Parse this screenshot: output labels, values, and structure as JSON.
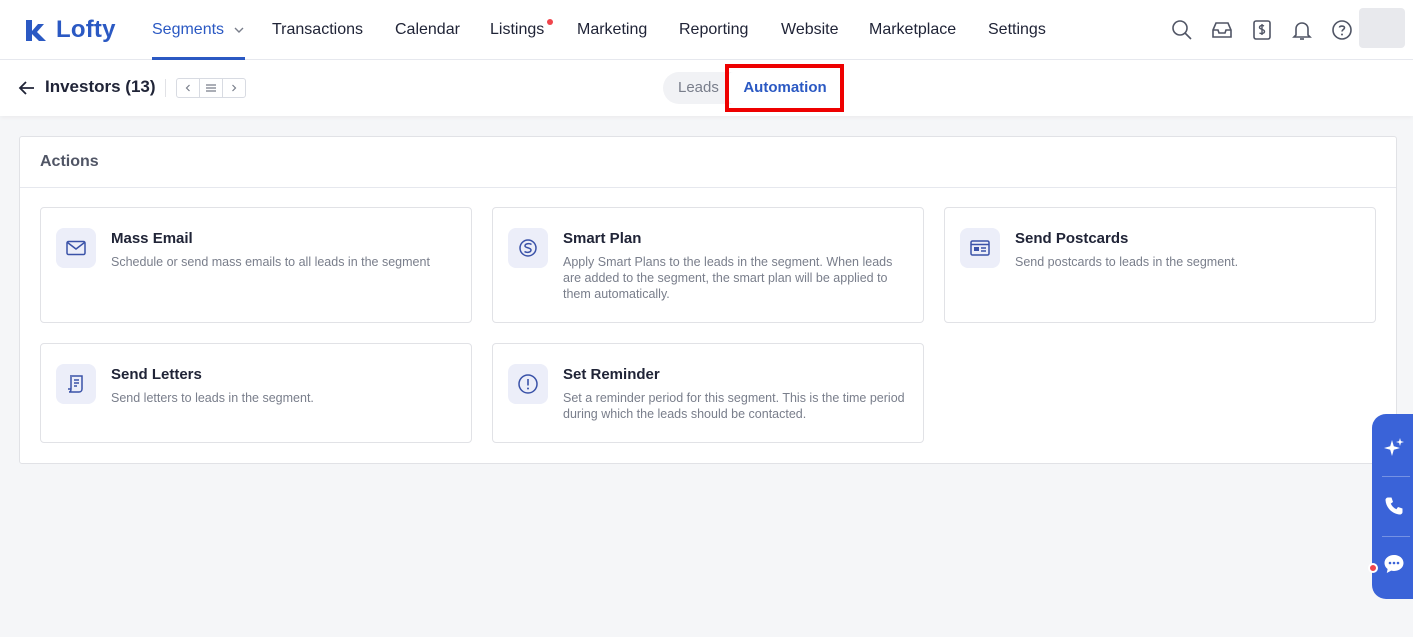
{
  "brand": {
    "name": "Lofty",
    "color": "#2b59c3"
  },
  "nav": {
    "items": [
      {
        "label": "Segments",
        "active": true,
        "has_dropdown": true
      },
      {
        "label": "Transactions"
      },
      {
        "label": "Calendar"
      },
      {
        "label": "Listings",
        "has_dot": true
      },
      {
        "label": "Marketing"
      },
      {
        "label": "Reporting"
      },
      {
        "label": "Website"
      },
      {
        "label": "Marketplace"
      },
      {
        "label": "Settings"
      }
    ],
    "tools": [
      "search-icon",
      "inbox-icon",
      "billing-icon",
      "bell-icon",
      "help-icon"
    ]
  },
  "subheader": {
    "title": "Investors (13)",
    "tabs": [
      {
        "label": "Leads",
        "active": false
      },
      {
        "label": "Automation",
        "active": true
      }
    ]
  },
  "actions": {
    "title": "Actions",
    "cards": [
      {
        "icon": "mail-icon",
        "title": "Mass Email",
        "desc": "Schedule or send mass emails to all leads in the segment"
      },
      {
        "icon": "smart-plan-icon",
        "title": "Smart Plan",
        "desc": "Apply Smart Plans to the leads in the segment. When leads are added to the segment, the smart plan will be applied to them automatically."
      },
      {
        "icon": "postcard-icon",
        "title": "Send Postcards",
        "desc": "Send postcards to leads in the segment."
      },
      {
        "icon": "letter-icon",
        "title": "Send Letters",
        "desc": "Send letters to leads in the segment."
      },
      {
        "icon": "reminder-icon",
        "title": "Set Reminder",
        "desc": "Set a reminder period for this segment. This is the time period during which the leads should be contacted."
      }
    ]
  },
  "dock": [
    "sparkle-icon",
    "phone-icon",
    "chat-icon"
  ],
  "colors": {
    "accent": "#2b59c3",
    "dock": "#3a63d8",
    "alert_dot": "#f0454c",
    "highlight": "#ee0000"
  }
}
